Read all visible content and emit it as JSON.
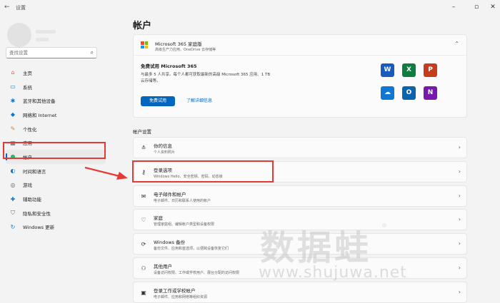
{
  "window": {
    "app_title": "设置",
    "controls": [
      "minimize",
      "maximize",
      "close"
    ]
  },
  "sidebar": {
    "search_placeholder": "查找设置",
    "items": [
      {
        "label": "主页",
        "icon": "home-icon",
        "glyph": "⌂",
        "color": "#e05c4b"
      },
      {
        "label": "系统",
        "icon": "system-icon",
        "glyph": "▭",
        "color": "#0a78d4"
      },
      {
        "label": "蓝牙和其他设备",
        "icon": "bluetooth-icon",
        "glyph": "✱",
        "color": "#0a78d4"
      },
      {
        "label": "网络和 Internet",
        "icon": "network-icon",
        "glyph": "◆",
        "color": "#0a78d4"
      },
      {
        "label": "个性化",
        "icon": "personalization-icon",
        "glyph": "✎",
        "color": "#d97e2a"
      },
      {
        "label": "应用",
        "icon": "apps-icon",
        "glyph": "▦",
        "color": "#5a6470"
      },
      {
        "label": "帐户",
        "icon": "accounts-icon",
        "glyph": "●",
        "color": "#2bb673",
        "active": true
      },
      {
        "label": "时间和语言",
        "icon": "time-language-icon",
        "glyph": "◐",
        "color": "#0a78d4"
      },
      {
        "label": "游戏",
        "icon": "gaming-icon",
        "glyph": "◎",
        "color": "#5a6470"
      },
      {
        "label": "辅助功能",
        "icon": "accessibility-icon",
        "glyph": "✚",
        "color": "#0a78d4"
      },
      {
        "label": "隐私和安全性",
        "icon": "privacy-icon",
        "glyph": "⛉",
        "color": "#5a6470"
      },
      {
        "label": "Windows 更新",
        "icon": "windows-update-icon",
        "glyph": "↻",
        "color": "#0a78d4"
      }
    ]
  },
  "main": {
    "title": "帐户",
    "microsoft365": {
      "name": "Microsoft 365 家庭版",
      "subtitle": "高级生产力应用、OneDrive 云存储等",
      "trial_title": "免费试用 Microsoft 365",
      "trial_desc": "与最多 5 人共享。每个人都可获取最新的高级 Microsoft 365 应用、1 TB 云存储等。",
      "primary_button": "免费试用",
      "link": "了解详细信息",
      "apps": [
        {
          "icon": "word-icon",
          "letter": "W",
          "color": "#185abd"
        },
        {
          "icon": "excel-icon",
          "letter": "X",
          "color": "#107c41"
        },
        {
          "icon": "powerpoint-icon",
          "letter": "P",
          "color": "#c43e1c"
        },
        {
          "icon": "onedrive-icon",
          "letter": "☁",
          "color": "#0f78d4"
        },
        {
          "icon": "outlook-icon",
          "letter": "O",
          "color": "#0a64ad"
        },
        {
          "icon": "onenote-icon",
          "letter": "N",
          "color": "#7719aa"
        }
      ]
    },
    "section_label": "帐户设置",
    "rows": [
      {
        "title": "你的信息",
        "subtitle": "个人资料照片",
        "icon": "your-info-icon",
        "glyph": "≗"
      },
      {
        "title": "登录选项",
        "subtitle": "Windows Hello、安全密钥、密码、动态锁",
        "icon": "key-icon",
        "glyph": "⚷"
      },
      {
        "title": "电子邮件和帐户",
        "subtitle": "电子邮件、日历和联系人使用的帐户",
        "icon": "mail-icon",
        "glyph": "✉"
      },
      {
        "title": "家庭",
        "subtitle": "管理家庭组、编辑帐户类型和设备权限",
        "icon": "family-icon",
        "glyph": "♡"
      },
      {
        "title": "Windows 备份",
        "subtitle": "备份文件、应用和首选项，以便跨设备恢复它们",
        "icon": "backup-icon",
        "glyph": "⟳"
      },
      {
        "title": "其他用户",
        "subtitle": "设备访问权限、工作或学校用户、展台分配的访问权限",
        "icon": "other-users-icon",
        "glyph": "⚇"
      },
      {
        "title": "登录工作或学校帐户",
        "subtitle": "电子邮件、应用和网络等组织资源",
        "icon": "briefcase-icon",
        "glyph": "▣"
      }
    ]
  },
  "watermark": {
    "text": "数据蛙",
    "url": "www.shujuwa.net",
    "mark": "®"
  },
  "annotation_color": "#e53935"
}
